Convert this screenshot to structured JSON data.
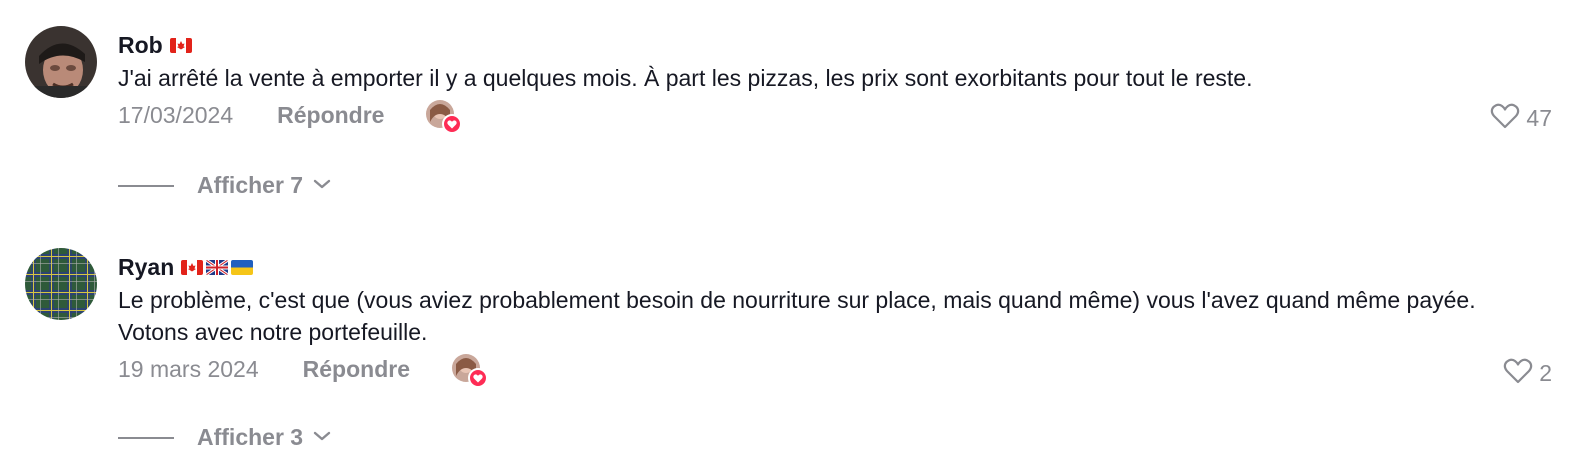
{
  "comments": [
    {
      "author": "Rob",
      "flags": [
        "canada"
      ],
      "text": "J'ai arrêté la vente à emporter il y a quelques mois. À part les pizzas, les prix sont exorbitants pour tout le reste.",
      "date": "17/03/2024",
      "reply_label": "Répondre",
      "likes": "47",
      "view_replies": "Afficher 7"
    },
    {
      "author": "Ryan",
      "flags": [
        "canada",
        "united-kingdom",
        "ukraine"
      ],
      "text": "Le problème, c'est que (vous aviez probablement besoin de nourriture sur place, mais quand même) vous l'avez quand même payée. Votons avec notre portefeuille.",
      "date": "19 mars 2024",
      "reply_label": "Répondre",
      "likes": "2",
      "view_replies": "Afficher 3"
    }
  ],
  "colors": {
    "text": "#161823",
    "muted": "#8a8b91",
    "heart_badge": "#fe2c55"
  },
  "icons": [
    "heart-outline-icon",
    "chevron-down-icon",
    "creator-heart-badge-icon"
  ]
}
